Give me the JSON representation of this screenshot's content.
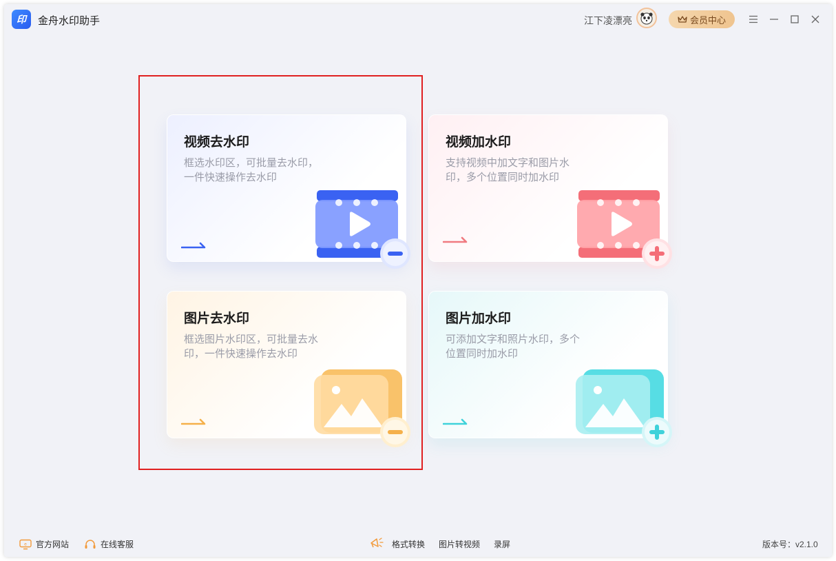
{
  "app": {
    "logo_text": "印",
    "title": "金舟水印助手"
  },
  "header": {
    "username": "江下凌漂亮",
    "vip_label": "会员中心"
  },
  "cards": [
    {
      "title": "视频去水印",
      "desc": "框选水印区，可批量去水印，一件快速操作去水印",
      "accent": "#3a62f2",
      "icon": "video-remove-icon"
    },
    {
      "title": "视频加水印",
      "desc": "支持视频中加文字和图片水印，多个位置同时加水印",
      "accent": "#f07a80",
      "icon": "video-add-icon"
    },
    {
      "title": "图片去水印",
      "desc": "框选图片水印区，可批量去水印，一件快速操作去水印",
      "accent": "#f5b04a",
      "icon": "image-remove-icon"
    },
    {
      "title": "图片加水印",
      "desc": "可添加文字和照片水印，多个位置同时加水印",
      "accent": "#3fd2da",
      "icon": "image-add-icon"
    }
  ],
  "footer": {
    "website": "官方网站",
    "support": "在线客服",
    "format_convert": "格式转换",
    "image_to_video": "图片转视频",
    "screen_record": "录屏",
    "version": "版本号：v2.1.0"
  },
  "colors": {
    "highlight_frame": "#e02020",
    "background": "#f1f2f7",
    "vip_gold": "#efc48f"
  }
}
